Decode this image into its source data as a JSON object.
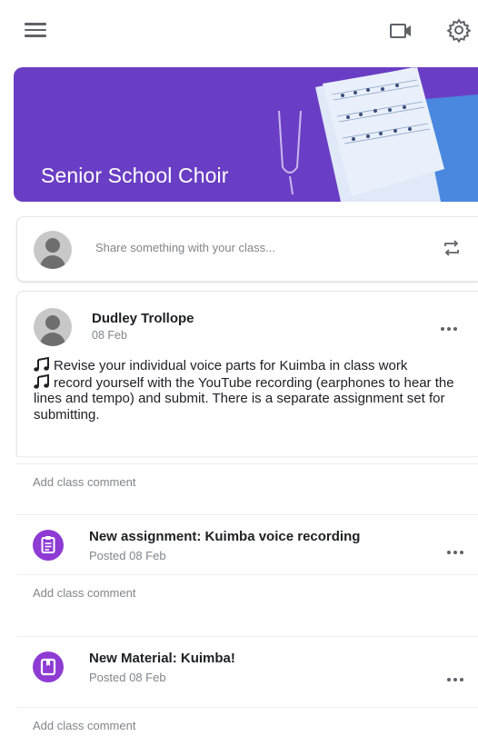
{
  "top_bar": {
    "menu_icon": "hamburger-menu-icon",
    "video_icon": "video-camera-icon",
    "settings_icon": "gear-icon"
  },
  "banner": {
    "title": "Senior School Choir",
    "color": "#6a3ec4"
  },
  "share": {
    "placeholder": "Share something with your class..."
  },
  "post": {
    "author": "Dudley Trollope",
    "date": "08 Feb",
    "line1": "Revise your individual voice parts for Kuimba in class work",
    "line2": "record yourself with the YouTube recording (earphones to hear the lines and tempo) and submit. There is a separate assignment set for submitting."
  },
  "comment_placeholder": "Add class comment",
  "stream_items": [
    {
      "title": "New assignment: Kuimba voice recording",
      "subtitle": "Posted 08 Feb",
      "icon": "assignment-icon"
    },
    {
      "title": "New Material: Kuimba!",
      "subtitle": "Posted 08 Feb",
      "icon": "material-icon"
    }
  ],
  "colors": {
    "accent": "#8e3bd4",
    "banner": "#6a3ec4",
    "secondary_text": "#80868b"
  }
}
